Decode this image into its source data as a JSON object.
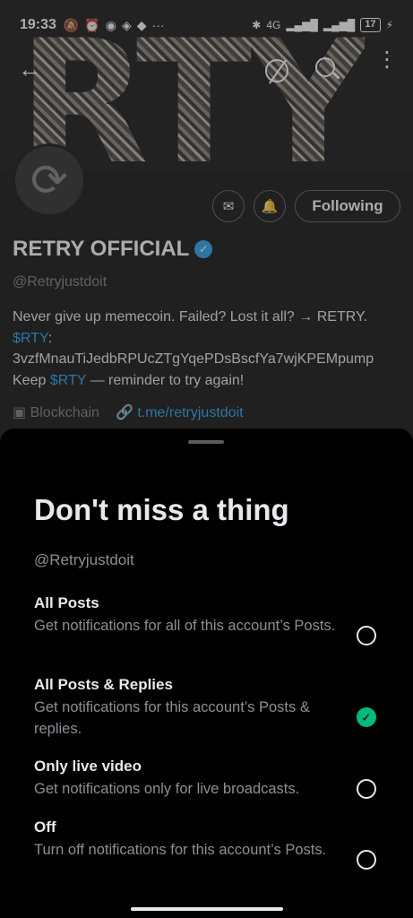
{
  "status_bar": {
    "time": "19:33",
    "network": "4G",
    "battery": "17"
  },
  "profile": {
    "banner_text": "RTY",
    "name": "RETRY OFFICIAL",
    "handle": "@Retryjustdoit",
    "bio_part1": "Never give up memecoin.  Failed? Lost it all? → RETRY.  ",
    "bio_ticker1": "$RTY",
    "bio_part2": ": 3vzfMnauTiJedbRPUcZTgYqePDsBscfYa7wjKPEMpump  Keep ",
    "bio_ticker2": "$RTY",
    "bio_part3": " — reminder to try again!",
    "category": "Blockchain",
    "link": "t.me/retryjustdoit",
    "following_label": "Following"
  },
  "sheet": {
    "title": "Don't miss a thing",
    "handle": "@Retryjustdoit",
    "options": [
      {
        "title": "All Posts",
        "desc": "Get notifications for all of this account’s Posts.",
        "selected": false
      },
      {
        "title": "All Posts & Replies",
        "desc": "Get notifications for this account’s Posts & replies.",
        "selected": true
      },
      {
        "title": "Only live video",
        "desc": "Get notifications only for live broadcasts.",
        "selected": false
      },
      {
        "title": "Off",
        "desc": "Turn off notifications for this account’s Posts.",
        "selected": false
      }
    ]
  },
  "colors": {
    "accent": "#1d9bf0",
    "selected": "#00ba7c",
    "muted": "#8b9095"
  },
  "icons": [
    "back-arrow-icon",
    "grok-icon",
    "search-icon",
    "more-icon",
    "retry-avatar-icon",
    "message-icon",
    "bell-icon",
    "verified-icon",
    "briefcase-icon",
    "link-icon",
    "check-icon"
  ]
}
